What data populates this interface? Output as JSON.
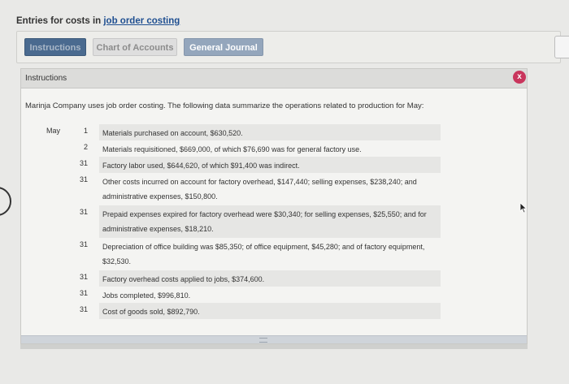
{
  "page": {
    "title_prefix": "Entries for costs in ",
    "title_link": "job order costing"
  },
  "tabs": [
    {
      "label": "Instructions"
    },
    {
      "label": "Chart of Accounts"
    },
    {
      "label": "General Journal"
    }
  ],
  "panel": {
    "header": "Instructions",
    "close_glyph": "x",
    "intro": "Marinja Company uses job order costing. The following data summarize the operations related to production for May:",
    "month": "May",
    "items": [
      {
        "day": "1",
        "lines": [
          "Materials purchased on account, $630,520."
        ]
      },
      {
        "day": "2",
        "lines": [
          "Materials requisitioned, $669,000, of which $76,690 was for general factory use."
        ]
      },
      {
        "day": "31",
        "lines": [
          "Factory labor used, $644,620, of which $91,400 was indirect."
        ]
      },
      {
        "day": "31",
        "lines": [
          "Other costs incurred on account for factory overhead, $147,440; selling expenses, $238,240; and",
          "administrative expenses, $150,800."
        ]
      },
      {
        "day": "31",
        "lines": [
          "Prepaid expenses expired for factory overhead were $30,340; for selling expenses, $25,550; and for",
          "administrative expenses, $18,210."
        ]
      },
      {
        "day": "31",
        "lines": [
          "Depreciation of office building was $85,350; of office equipment, $45,280; and of factory equipment,",
          "$32,530."
        ]
      },
      {
        "day": "31",
        "lines": [
          "Factory overhead costs applied to jobs, $374,600."
        ]
      },
      {
        "day": "31",
        "lines": [
          "Jobs completed, $996,810."
        ]
      },
      {
        "day": "31",
        "lines": [
          "Cost of goods sold, $892,790."
        ]
      }
    ]
  },
  "colors": {
    "tab_active": "#4a6a8f",
    "tab_journal": "#94a6bc",
    "close": "#c9355c",
    "link": "#1f4f91"
  }
}
